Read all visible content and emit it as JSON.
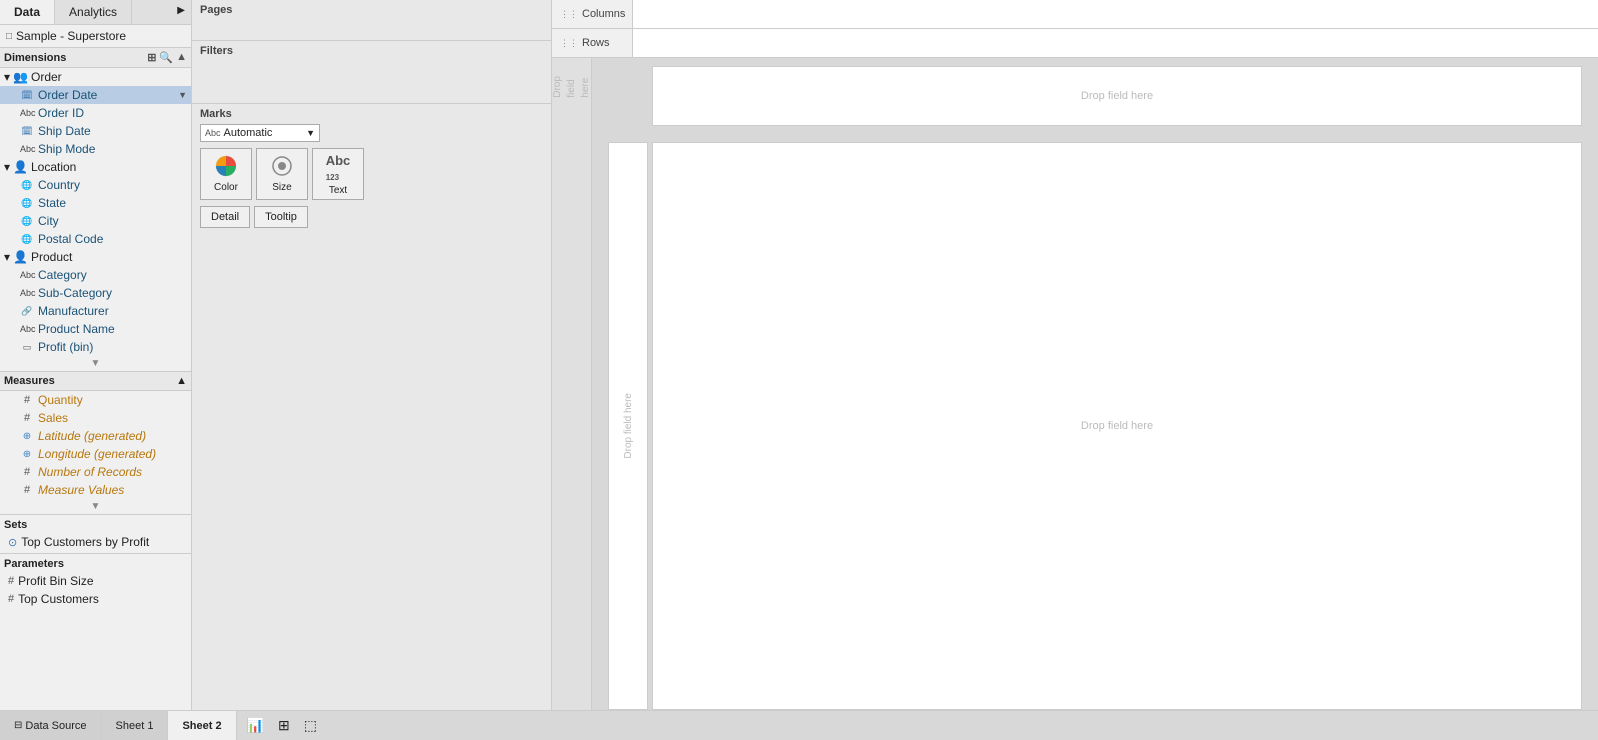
{
  "panelTabs": {
    "data": "Data",
    "analytics": "Analytics"
  },
  "dataSource": {
    "icon": "□",
    "name": "Sample - Superstore"
  },
  "dimensions": {
    "label": "Dimensions",
    "groups": [
      {
        "name": "Order",
        "icon": "folder",
        "fields": [
          {
            "type": "calendar",
            "label": "Order Date",
            "selected": true
          },
          {
            "type": "abc",
            "label": "Order ID"
          },
          {
            "type": "calendar",
            "label": "Ship Date"
          },
          {
            "type": "abc",
            "label": "Ship Mode"
          }
        ]
      },
      {
        "name": "Location",
        "icon": "person",
        "fields": [
          {
            "type": "globe",
            "label": "Country"
          },
          {
            "type": "globe",
            "label": "State"
          },
          {
            "type": "globe",
            "label": "City"
          },
          {
            "type": "globe",
            "label": "Postal Code"
          }
        ]
      },
      {
        "name": "Product",
        "icon": "person",
        "fields": [
          {
            "type": "abc",
            "label": "Category"
          },
          {
            "type": "abc",
            "label": "Sub-Category"
          },
          {
            "type": "link",
            "label": "Manufacturer"
          },
          {
            "type": "abc",
            "label": "Product Name"
          },
          {
            "type": "bin",
            "label": "Profit (bin)"
          }
        ]
      }
    ]
  },
  "measures": {
    "label": "Measures",
    "fields": [
      {
        "type": "hash",
        "label": "Quantity"
      },
      {
        "type": "hash",
        "label": "Sales"
      },
      {
        "type": "geo",
        "label": "Latitude (generated)",
        "italic": true
      },
      {
        "type": "geo",
        "label": "Longitude (generated)",
        "italic": true
      },
      {
        "type": "hash",
        "label": "Number of Records",
        "italic": true
      },
      {
        "type": "hash",
        "label": "Measure Values",
        "italic": true
      }
    ]
  },
  "sets": {
    "label": "Sets",
    "items": [
      {
        "label": "Top Customers by Profit"
      }
    ]
  },
  "parameters": {
    "label": "Parameters",
    "items": [
      {
        "label": "Profit Bin Size"
      },
      {
        "label": "Top Customers"
      }
    ]
  },
  "shelves": {
    "pages": {
      "label": "Pages"
    },
    "filters": {
      "label": "Filters"
    },
    "marks": {
      "label": "Marks",
      "typeLabel": "Automatic",
      "typeIcon": "Abc",
      "buttons": [
        {
          "label": "Color"
        },
        {
          "label": "Size"
        },
        {
          "label": "Text"
        },
        {
          "label": "Detail"
        },
        {
          "label": "Tooltip"
        }
      ]
    },
    "columns": {
      "label": "Columns"
    },
    "rows": {
      "label": "Rows"
    }
  },
  "canvas": {
    "dropHereLabels": [
      "Drop field here",
      "Drop field here",
      "Drop field here"
    ],
    "dropLeft": "Drop\nfield\nhere"
  },
  "bottomBar": {
    "dataSourceTab": "Data Source",
    "tabs": [
      {
        "label": "Sheet 1"
      },
      {
        "label": "Sheet 2",
        "active": true
      }
    ],
    "icons": [
      "📊",
      "⊞",
      "⬚"
    ]
  }
}
